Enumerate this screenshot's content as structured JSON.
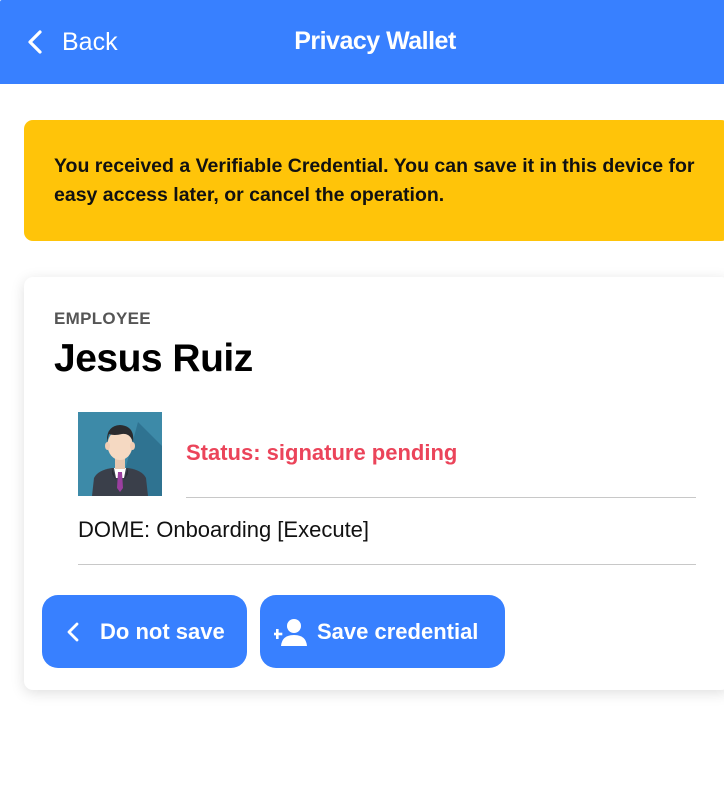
{
  "header": {
    "back_label": "Back",
    "title": "Privacy Wallet"
  },
  "alert": {
    "message": "You received a Verifiable Credential. You can save it in this device for easy access later, or cancel the operation.",
    "color": "#ffc409"
  },
  "credential": {
    "subtitle": "EMPLOYEE",
    "name": "Jesus Ruiz",
    "avatar": "employee-avatar",
    "status": "Status: signature pending",
    "status_color": "#eb445a",
    "item": "DOME: Onboarding [Execute]"
  },
  "actions": {
    "do_not_save_label": "Do not save",
    "save_label": "Save credential"
  },
  "colors": {
    "primary": "#3880ff"
  },
  "icons": {
    "back": "chevron-left-icon",
    "do_not_save": "chevron-left-icon",
    "save": "person-add-icon"
  }
}
